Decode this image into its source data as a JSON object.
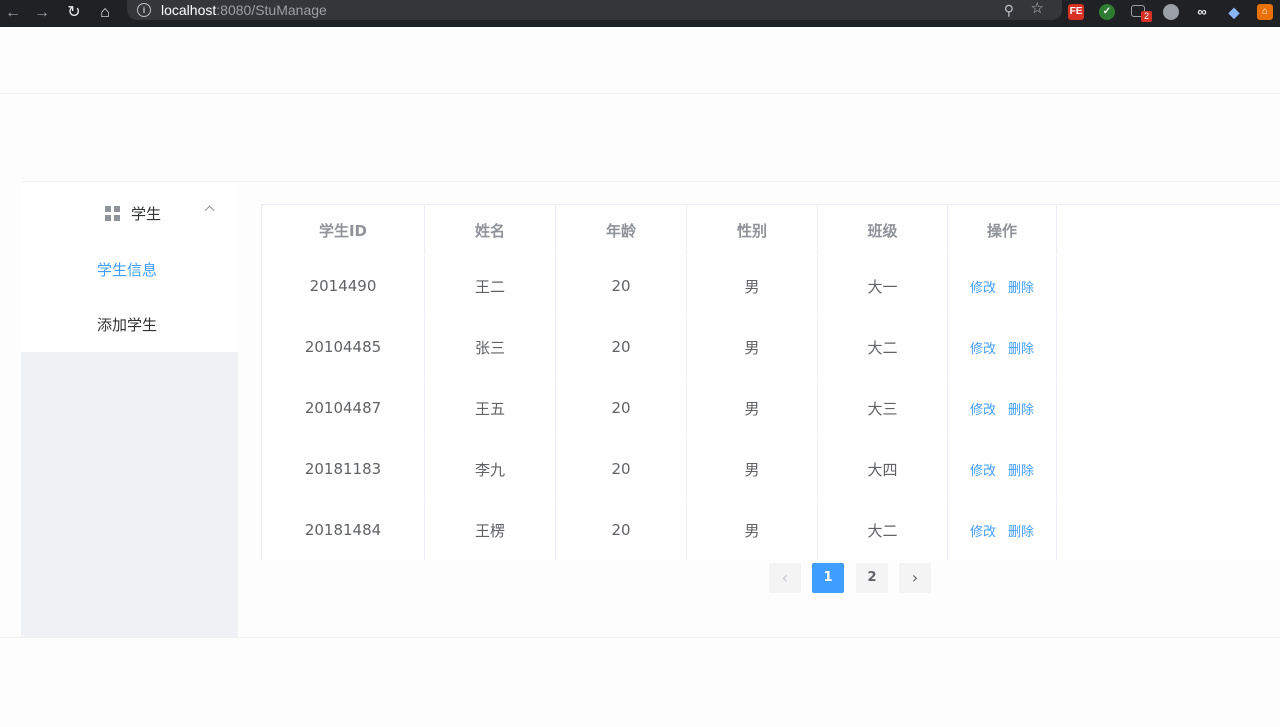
{
  "browser": {
    "url_host": "localhost",
    "url_port": ":8080",
    "url_path": "/StuManage",
    "ext_badge": "2"
  },
  "sidebar": {
    "submenu_label": "学生",
    "items": [
      {
        "label": "学生信息",
        "active": true
      },
      {
        "label": "添加学生",
        "active": false
      }
    ]
  },
  "table": {
    "columns": [
      "学生ID",
      "姓名",
      "年龄",
      "性别",
      "班级",
      "操作"
    ],
    "rows": [
      {
        "id": "2014490",
        "name": "王二",
        "age": "20",
        "gender": "男",
        "class": "大一"
      },
      {
        "id": "20104485",
        "name": "张三",
        "age": "20",
        "gender": "男",
        "class": "大二"
      },
      {
        "id": "20104487",
        "name": "王五",
        "age": "20",
        "gender": "男",
        "class": "大三"
      },
      {
        "id": "20181183",
        "name": "李九",
        "age": "20",
        "gender": "男",
        "class": "大四"
      },
      {
        "id": "20181484",
        "name": "王楞",
        "age": "20",
        "gender": "男",
        "class": "大二"
      }
    ],
    "edit_label": "修改",
    "delete_label": "删除"
  },
  "pagination": {
    "prev": "‹",
    "pages": [
      "1",
      "2"
    ],
    "next": "›"
  },
  "colors": {
    "accent": "#409eff"
  }
}
